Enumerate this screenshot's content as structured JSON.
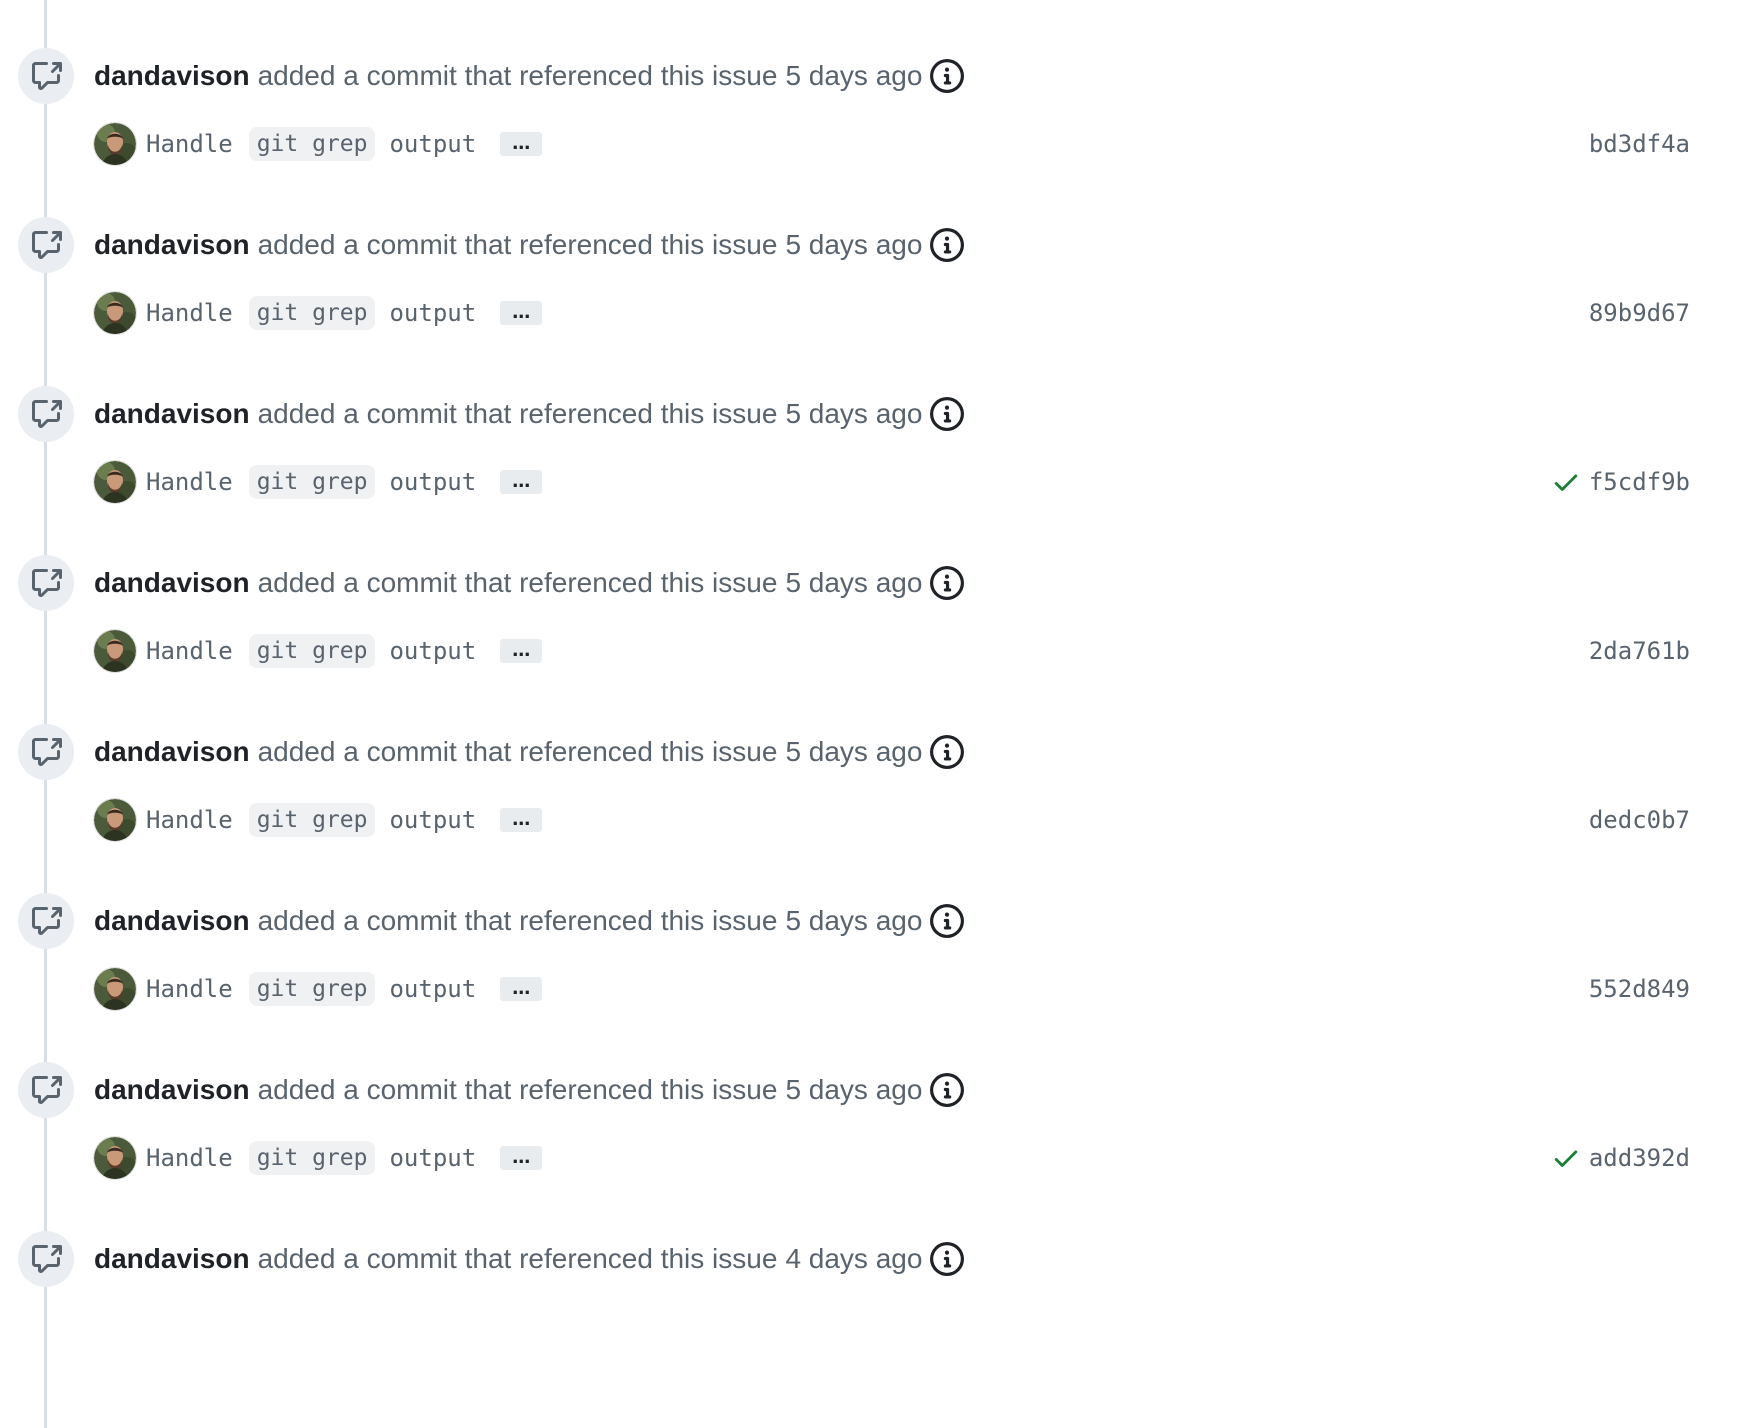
{
  "events": [
    {
      "actor": "dandavison",
      "action": "added a commit that referenced this issue",
      "time": "5 days ago",
      "commit": {
        "word1": "Handle",
        "code": "git grep",
        "word2": "output",
        "ellipsis": "…",
        "sha": "bd3df4a",
        "checked": false
      }
    },
    {
      "actor": "dandavison",
      "action": "added a commit that referenced this issue",
      "time": "5 days ago",
      "commit": {
        "word1": "Handle",
        "code": "git grep",
        "word2": "output",
        "ellipsis": "…",
        "sha": "89b9d67",
        "checked": false
      }
    },
    {
      "actor": "dandavison",
      "action": "added a commit that referenced this issue",
      "time": "5 days ago",
      "commit": {
        "word1": "Handle",
        "code": "git grep",
        "word2": "output",
        "ellipsis": "…",
        "sha": "f5cdf9b",
        "checked": true
      }
    },
    {
      "actor": "dandavison",
      "action": "added a commit that referenced this issue",
      "time": "5 days ago",
      "commit": {
        "word1": "Handle",
        "code": "git grep",
        "word2": "output",
        "ellipsis": "…",
        "sha": "2da761b",
        "checked": false
      }
    },
    {
      "actor": "dandavison",
      "action": "added a commit that referenced this issue",
      "time": "5 days ago",
      "commit": {
        "word1": "Handle",
        "code": "git grep",
        "word2": "output",
        "ellipsis": "…",
        "sha": "dedc0b7",
        "checked": false
      }
    },
    {
      "actor": "dandavison",
      "action": "added a commit that referenced this issue",
      "time": "5 days ago",
      "commit": {
        "word1": "Handle",
        "code": "git grep",
        "word2": "output",
        "ellipsis": "…",
        "sha": "552d849",
        "checked": false
      }
    },
    {
      "actor": "dandavison",
      "action": "added a commit that referenced this issue",
      "time": "5 days ago",
      "commit": {
        "word1": "Handle",
        "code": "git grep",
        "word2": "output",
        "ellipsis": "…",
        "sha": "add392d",
        "checked": true
      }
    },
    {
      "actor": "dandavison",
      "action": "added a commit that referenced this issue",
      "time": "4 days ago"
    }
  ],
  "colors": {
    "timeline_line": "#d8dee4",
    "badge_bg": "#eaeef2",
    "muted_text": "#59636e",
    "primary_text": "#1f2328",
    "success_check": "#1a7f37",
    "code_bg": "#eff1f3"
  },
  "icons": {
    "badge": "cross-reference-icon",
    "info": "info-icon",
    "check": "check-icon",
    "avatar": "user-avatar"
  }
}
